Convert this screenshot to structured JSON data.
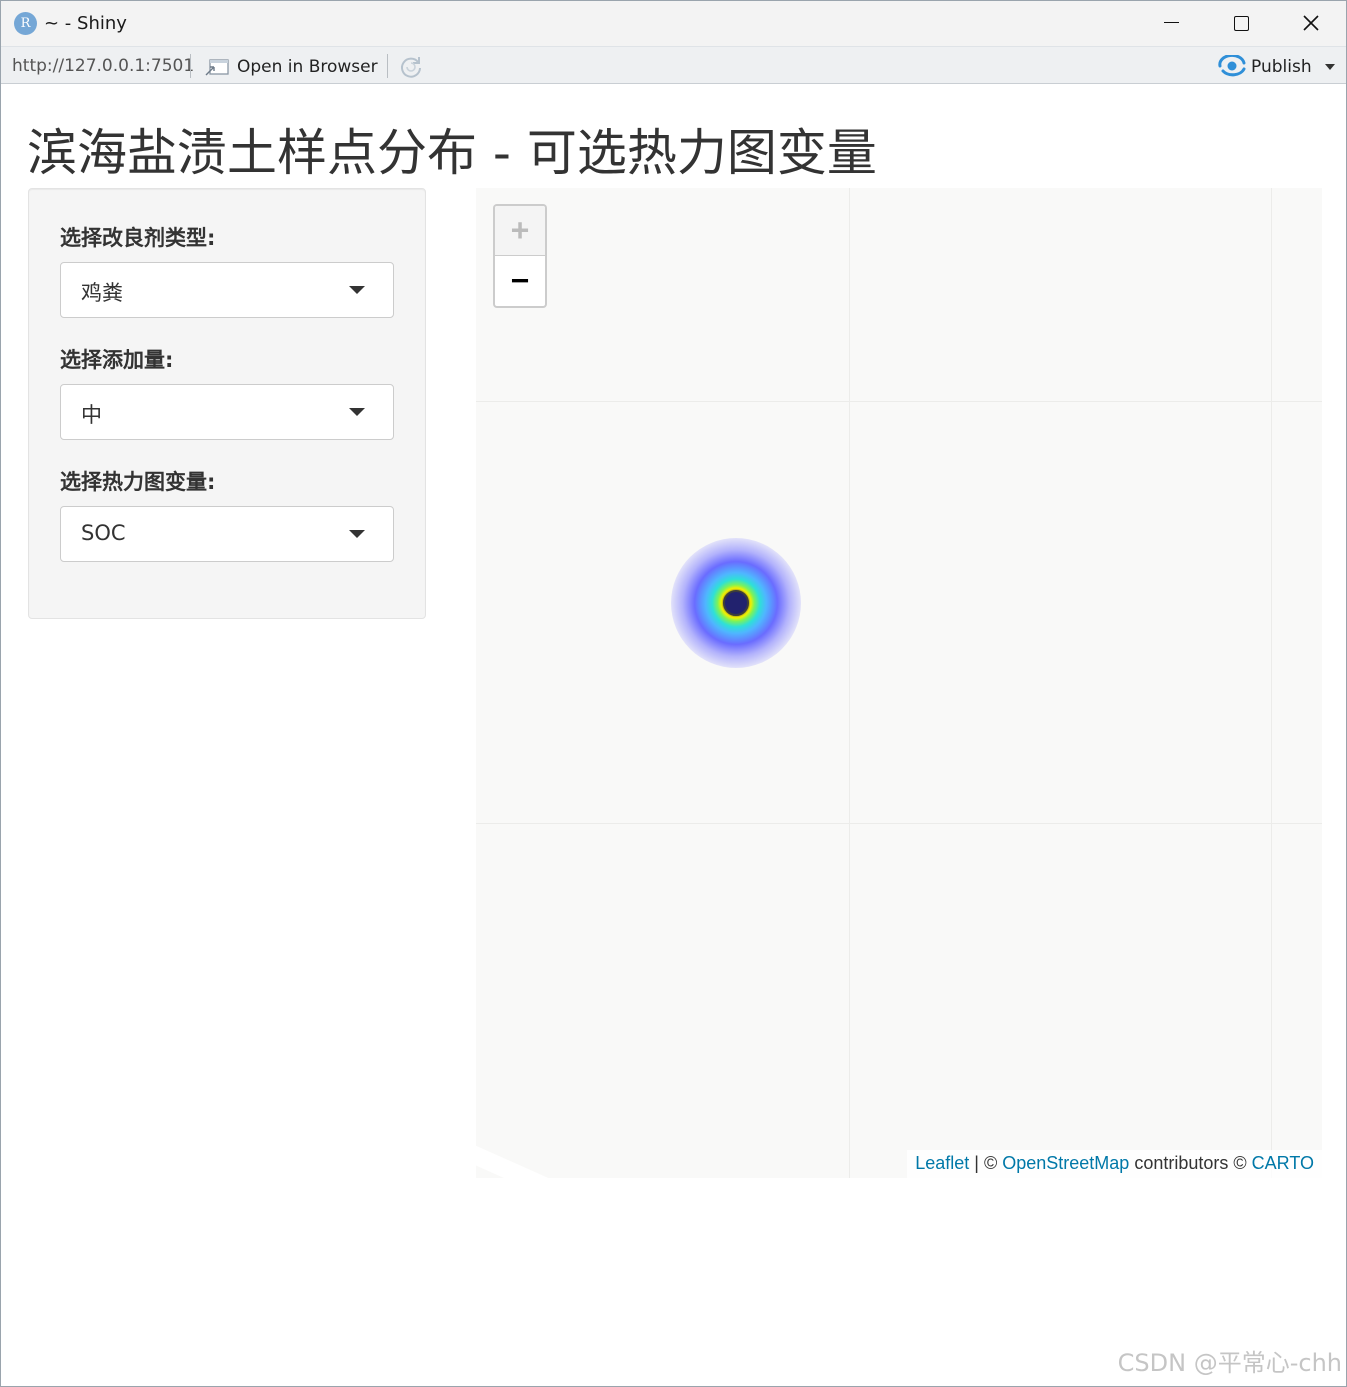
{
  "window": {
    "title": "~ - Shiny",
    "app_icon_letter": "R"
  },
  "toolbar": {
    "url": "http://127.0.0.1:7501",
    "open_in_browser_label": "Open in Browser",
    "publish_label": "Publish",
    "icons": [
      "open-browser-icon",
      "refresh-icon",
      "publish-icon",
      "chevron-down-icon"
    ]
  },
  "app": {
    "title": "滨海盐渍土样点分布 - 可选热力图变量",
    "controls": [
      {
        "label": "选择改良剂类型:",
        "value": "鸡粪"
      },
      {
        "label": "选择添加量:",
        "value": "中"
      },
      {
        "label": "选择热力图变量:",
        "value": "SOC"
      }
    ]
  },
  "map": {
    "zoom_in_label": "+",
    "zoom_out_label": "−",
    "attribution": {
      "leaflet": "Leaflet",
      "sep1": " | © ",
      "osm": "OpenStreetMap",
      "contrib": " contributors © ",
      "carto": "CARTO"
    },
    "colors": {
      "link": "#0078a8",
      "heat_core": "#19196b"
    }
  },
  "watermark": "CSDN @平常心-chh"
}
